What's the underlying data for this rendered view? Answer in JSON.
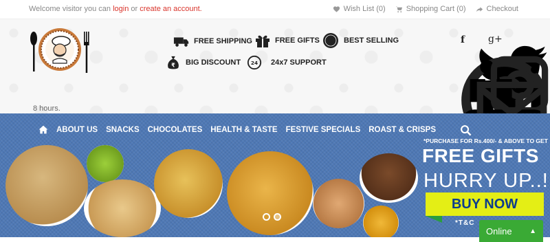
{
  "topbar": {
    "welcome_prefix": "Welcome visitor you can",
    "login_label": "login",
    "or_text": "or",
    "create_account_label": "create an account.",
    "wishlist_label": "Wish List (0)",
    "cart_label": "Shopping Cart (0)",
    "checkout_label": "Checkout"
  },
  "features": {
    "free_shipping": "FREE SHIPPING",
    "free_gifts": "FREE GIFTS",
    "best_selling": "BEST SELLING",
    "big_discount": "BIG DISCOUNT",
    "support": "24x7 SUPPORT",
    "support_badge": "24"
  },
  "social": {
    "facebook": "f",
    "google_plus": "g+"
  },
  "hours_text": "8 hours.",
  "nav": {
    "items": [
      "ABOUT US",
      "SNACKS",
      "CHOCOLATES",
      "HEALTH & TASTE",
      "FESTIVE SPECIALS",
      "ROAST & CRISPS"
    ]
  },
  "banner": {
    "promo_small": "*PURCHASE FOR Rs.400/- & ABOVE TO GET",
    "promo_free": "FREE GIFTS",
    "promo_hurry": "HURRY UP..!",
    "buy_now": "BUY NOW",
    "tc": "*T&C"
  },
  "chat": {
    "label": "Online"
  },
  "colors": {
    "accent_red": "#d9342b",
    "banner_blue": "#4e78b5",
    "buy_yellow": "#e4ee15",
    "chat_green": "#3aaa35"
  }
}
